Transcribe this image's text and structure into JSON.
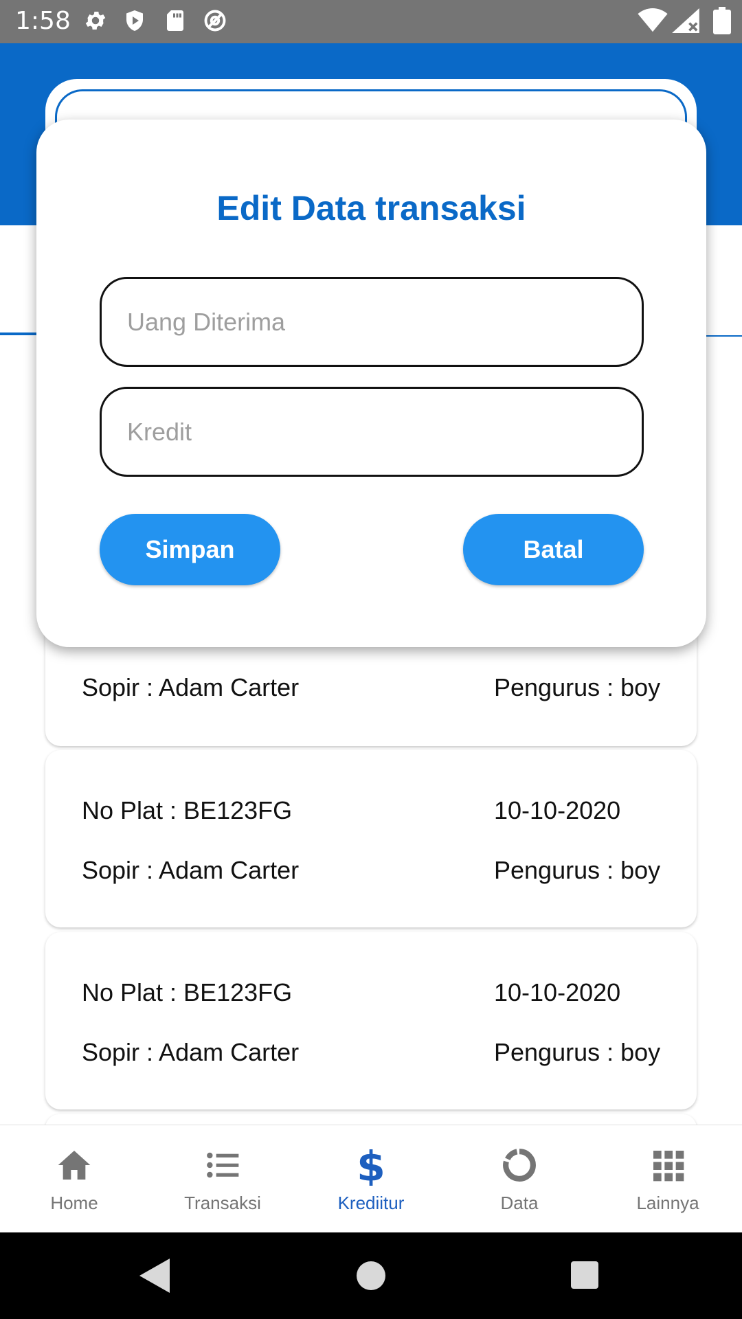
{
  "status_bar": {
    "time": "1:58",
    "left_icons": [
      "gear-icon",
      "shield-icon",
      "sd-card-icon",
      "at-sign-icon"
    ],
    "right_icons": [
      "wifi-icon",
      "signal-icon",
      "battery-icon"
    ]
  },
  "dialog": {
    "title": "Edit Data transaksi",
    "uang_diterima_placeholder": "Uang Diterima",
    "kredit_placeholder": "Kredit",
    "save_label": "Simpan",
    "cancel_label": "Batal"
  },
  "list": {
    "items": [
      {
        "no_plat": "",
        "date": "",
        "sopir": "Sopir : Adam Carter",
        "pengurus": "Pengurus : boy"
      },
      {
        "no_plat": "No Plat : BE123FG",
        "date": "10-10-2020",
        "sopir": "Sopir : Adam Carter",
        "pengurus": "Pengurus : boy"
      },
      {
        "no_plat": "No Plat : BE123FG",
        "date": "10-10-2020",
        "sopir": "Sopir : Adam Carter",
        "pengurus": "Pengurus : boy"
      }
    ]
  },
  "bottom_nav": {
    "items": [
      {
        "label": "Home",
        "icon": "home-icon"
      },
      {
        "label": "Transaksi",
        "icon": "list-icon"
      },
      {
        "label": "Krediitur",
        "icon": "dollar-icon"
      },
      {
        "label": "Data",
        "icon": "donut-chart-icon"
      },
      {
        "label": "Lainnya",
        "icon": "grid-icon"
      }
    ],
    "active_index": 2
  },
  "colors": {
    "primary": "#0a69c7",
    "button": "#2393f0",
    "active_nav": "#1d5fbf"
  }
}
